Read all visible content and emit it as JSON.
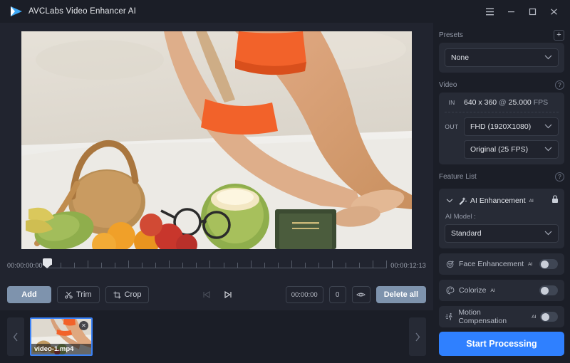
{
  "window": {
    "title": "AVCLabs Video Enhancer AI",
    "logo_icon": "play-triangle-logo",
    "controls": {
      "menu": "menu-icon",
      "minimize": "minimize-icon",
      "maximize": "maximize-icon",
      "close": "close-icon"
    }
  },
  "timeline": {
    "start_time": "00:00:00:00",
    "end_time": "00:00:12:13"
  },
  "toolbar": {
    "add_label": "Add",
    "trim_label": "Trim",
    "crop_label": "Crop",
    "prev_frame_icon": "skip-previous-icon",
    "next_frame_icon": "skip-next-icon",
    "time_value": "00:00:00",
    "frame_value": "0",
    "preview_eye_icon": "eye-icon",
    "delete_all_label": "Delete all"
  },
  "filmstrip": {
    "prev_arrow": "chevron-left-icon",
    "next_arrow": "chevron-right-icon",
    "items": [
      {
        "filename": "video-1.mp4",
        "close_icon": "close-circle-icon"
      }
    ]
  },
  "panel": {
    "presets": {
      "heading": "Presets",
      "add_icon": "plus-icon",
      "selected": "None",
      "chevron": "chevron-down-icon"
    },
    "video": {
      "heading": "Video",
      "help_icon": "help-icon",
      "in_tag": "IN",
      "in_resolution": "640 x 360",
      "in_sep": "@",
      "in_fps": "25.000",
      "in_fps_unit": "FPS",
      "out_tag": "OUT",
      "out_resolution": "FHD (1920X1080)",
      "out_framerate": "Original (25 FPS)"
    },
    "feature_list": {
      "heading": "Feature List",
      "help_icon": "help-icon",
      "ai_enhancement": {
        "collapse_icon": "chevron-down-icon",
        "icon": "magic-wand-icon",
        "title": "AI Enhancement",
        "badge": "AI",
        "lock_icon": "lock-icon",
        "model_label": "AI Model :",
        "model_value": "Standard",
        "model_chevron": "chevron-down-icon"
      },
      "features": [
        {
          "icon": "face-icon",
          "title": "Face Enhancement",
          "badge": "AI",
          "enabled": false
        },
        {
          "icon": "palette-icon",
          "title": "Colorize",
          "badge": "AI",
          "enabled": false
        },
        {
          "icon": "motion-icon",
          "title": "Motion Compensation",
          "badge": "AI",
          "enabled": false
        }
      ]
    },
    "start_button": "Start Processing"
  },
  "colors": {
    "accent": "#2f80ff",
    "button": "#7e93ad",
    "panel_bg": "#1b1e27",
    "card_bg": "#272b36",
    "selection": "#3b82f6"
  }
}
